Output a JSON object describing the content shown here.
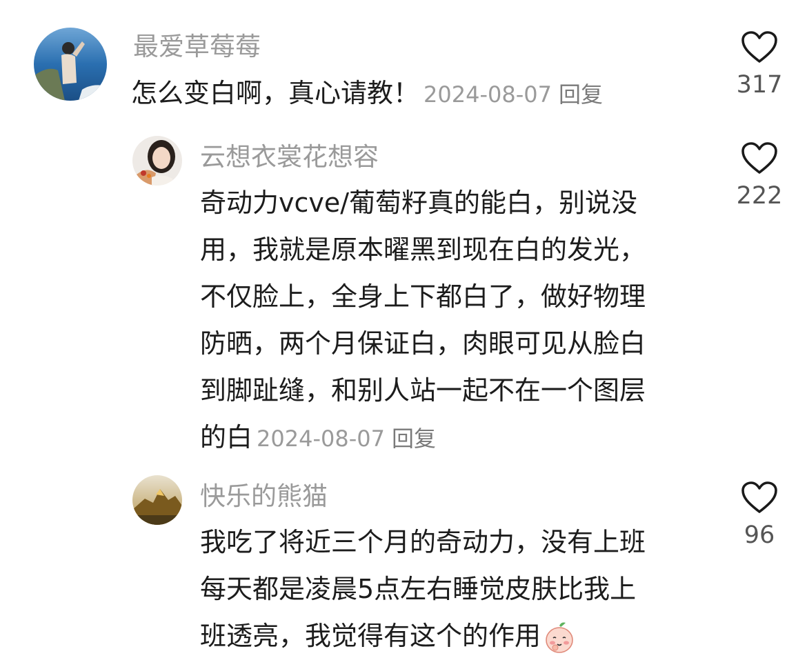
{
  "comments": [
    {
      "username": "最爱草莓莓",
      "text": "怎么变白啊，真心请教！",
      "date": "2024-08-07",
      "reply_label": "回复",
      "likes": "317"
    },
    {
      "username": "云想衣裳花想容",
      "lines": [
        "奇动力vcve/葡萄籽真的能白，别说没",
        "用，我就是原本曜黑到现在白的发光，",
        "不仅脸上，全身上下都白了，做好物理",
        "防晒，两个月保证白，肉眼可见从脸白",
        "到脚趾缝，和别人站一起不在一个图层",
        "的白"
      ],
      "date": "2024-08-07",
      "reply_label": "回复",
      "likes": "222"
    },
    {
      "username": "快乐的熊猫",
      "lines": [
        "我吃了将近三个月的奇动力，没有上班",
        "每天都是凌晨5点左右睡觉皮肤比我上",
        "班透亮，我觉得有这个的作用"
      ],
      "emoji": "peach-shy-emoji",
      "likes": "96"
    }
  ],
  "icons": {
    "like": "heart-outline-icon"
  },
  "colors": {
    "username": "#9a9a9a",
    "text": "#1c1c1c",
    "meta": "#9a9a9a"
  }
}
